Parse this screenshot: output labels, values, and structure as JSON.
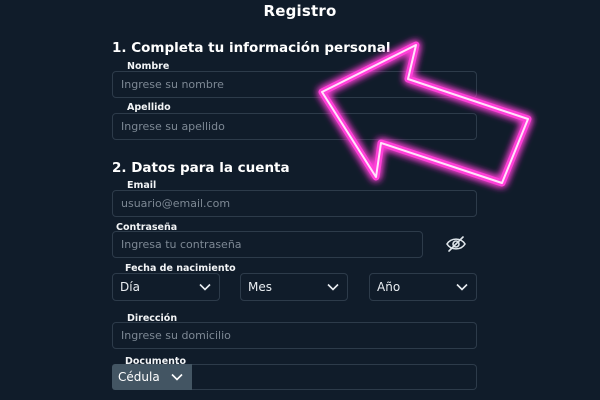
{
  "page": {
    "title": "Registro"
  },
  "section1": {
    "title": "1. Completa tu información personal",
    "nombre": {
      "label": "Nombre",
      "placeholder": "Ingrese su nombre"
    },
    "apellido": {
      "label": "Apellido",
      "placeholder": "Ingrese su apellido"
    }
  },
  "section2": {
    "title": "2. Datos para la cuenta",
    "email": {
      "label": "Email",
      "placeholder": "usuario@email.com"
    },
    "password": {
      "label": "Contraseña",
      "placeholder": "Ingresa tu contraseña",
      "toggle_icon": "eye-off-icon"
    },
    "birthdate": {
      "label": "Fecha de nacimiento",
      "day": {
        "value": "Día"
      },
      "month": {
        "value": "Mes"
      },
      "year": {
        "value": "Año"
      }
    },
    "address": {
      "label": "Dirección",
      "placeholder": "Ingrese su domicilio"
    },
    "document": {
      "label": "Documento",
      "type_value": "Cédula",
      "number_value": ""
    }
  },
  "overlay": {
    "icon": "neon-arrow-icon",
    "color": "#ff3fd8"
  },
  "colors": {
    "background": "#101c2a",
    "border": "#2d3b4a",
    "doc_select_bg": "#435563"
  }
}
